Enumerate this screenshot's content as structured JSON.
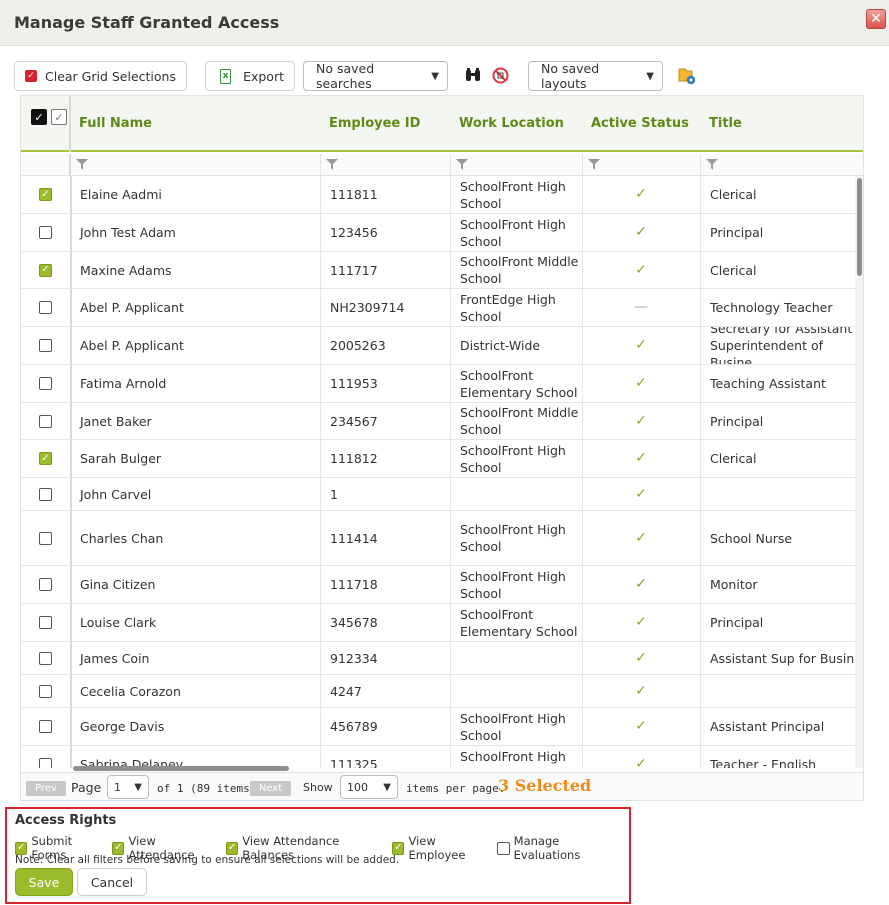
{
  "dialog": {
    "title": "Manage Staff Granted Access",
    "close_glyph": "✕"
  },
  "toolbar": {
    "clear_label": "Clear Grid Selections",
    "export_label": "Export",
    "saved_searches": "No saved searches",
    "saved_layouts": "No saved layouts"
  },
  "grid": {
    "columns": {
      "full_name": "Full Name",
      "employee_id": "Employee ID",
      "work_location": "Work Location",
      "active_status": "Active Status",
      "title": "Title"
    },
    "rows": [
      {
        "checked": true,
        "name": "Elaine Aadmi",
        "emp": "111811",
        "loc": "SchoolFront High School",
        "active": true,
        "title": "Clerical"
      },
      {
        "checked": false,
        "name": "John Test Adam",
        "emp": "123456",
        "loc": "SchoolFront High School",
        "active": true,
        "title": "Principal"
      },
      {
        "checked": true,
        "name": "Maxine Adams",
        "emp": "111717",
        "loc": "SchoolFront Middle School",
        "active": true,
        "title": "Clerical"
      },
      {
        "checked": false,
        "name": "Abel P. Applicant",
        "emp": "NH2309714",
        "loc": "FrontEdge High School",
        "active": false,
        "title": "Technology Teacher"
      },
      {
        "checked": false,
        "name": "Abel P. Applicant",
        "emp": "2005263",
        "loc": "District-Wide",
        "active": true,
        "title": "Secretary for Assistant Superintendent of Busine"
      },
      {
        "checked": false,
        "name": "Fatima Arnold",
        "emp": "111953",
        "loc": "SchoolFront Elementary School",
        "active": true,
        "title": "Teaching Assistant"
      },
      {
        "checked": false,
        "name": "Janet Baker",
        "emp": "234567",
        "loc": "SchoolFront Middle School",
        "active": true,
        "title": "Principal"
      },
      {
        "checked": true,
        "name": "Sarah Bulger",
        "emp": "111812",
        "loc": "SchoolFront High School",
        "active": true,
        "title": "Clerical"
      },
      {
        "checked": false,
        "name": "John Carvel",
        "emp": "1",
        "loc": "",
        "active": true,
        "title": ""
      },
      {
        "checked": false,
        "name": "Charles Chan",
        "emp": "111414",
        "loc": "SchoolFront High School",
        "active": true,
        "title": "School Nurse"
      },
      {
        "checked": false,
        "name": "Gina Citizen",
        "emp": "111718",
        "loc": "SchoolFront High School",
        "active": true,
        "title": "Monitor"
      },
      {
        "checked": false,
        "name": "Louise Clark",
        "emp": "345678",
        "loc": "SchoolFront Elementary School",
        "active": true,
        "title": "Principal"
      },
      {
        "checked": false,
        "name": "James Coin",
        "emp": "912334",
        "loc": "",
        "active": true,
        "title": "Assistant Sup for Business"
      },
      {
        "checked": false,
        "name": "Cecelia Corazon",
        "emp": "4247",
        "loc": "",
        "active": true,
        "title": ""
      },
      {
        "checked": false,
        "name": "George Davis",
        "emp": "456789",
        "loc": "SchoolFront High School",
        "active": true,
        "title": "Assistant Principal"
      },
      {
        "checked": false,
        "name": "Sabrina Delaney",
        "emp": "111325",
        "loc": "SchoolFront High School",
        "active": true,
        "title": "Teacher - English"
      }
    ]
  },
  "pager": {
    "prev": "Prev",
    "page_label": "Page",
    "page_value": "1",
    "of_text": "of 1 (89 items)",
    "next": "Next",
    "show_label": "Show",
    "per_page_value": "100",
    "per_page_text": "items per page.",
    "selected_text": "3 Selected"
  },
  "rights": {
    "title": "Access Rights",
    "items": [
      {
        "label": "Submit Forms",
        "checked": true
      },
      {
        "label": "View Attendance",
        "checked": true
      },
      {
        "label": "View Attendance Balances",
        "checked": true
      },
      {
        "label": "View Employee",
        "checked": true
      },
      {
        "label": "Manage Evaluations",
        "checked": false
      }
    ],
    "note": "Note: Clear all filters before saving to ensure all selections will be added.",
    "save": "Save",
    "cancel": "Cancel"
  },
  "colors": {
    "accent": "#9bbb2a",
    "header_text": "#5f8a16",
    "danger": "#d9232d",
    "selected": "#f08a14"
  }
}
